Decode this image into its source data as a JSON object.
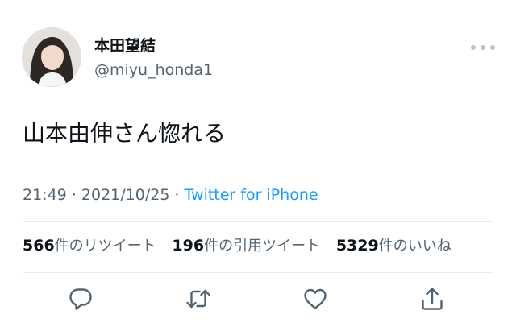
{
  "author": {
    "display_name": "本田望結",
    "handle": "@miyu_honda1"
  },
  "tweet": {
    "text": "山本由伸さん惚れる",
    "time": "21:49",
    "separator": "·",
    "date": "2021/10/25",
    "source": "Twitter for iPhone"
  },
  "stats": {
    "retweets": {
      "count": "566",
      "label": "件のリツイート"
    },
    "quotes": {
      "count": "196",
      "label": "件の引用ツイート"
    },
    "likes": {
      "count": "5329",
      "label": "件のいいね"
    }
  },
  "icons": {
    "more": "more-icon",
    "reply": "reply-icon",
    "retweet": "retweet-icon",
    "like": "heart-icon",
    "share": "share-icon"
  },
  "colors": {
    "link": "#1d9bf0",
    "secondary_text": "#536471",
    "icon": "#536471",
    "divider": "#e6ecf0"
  }
}
